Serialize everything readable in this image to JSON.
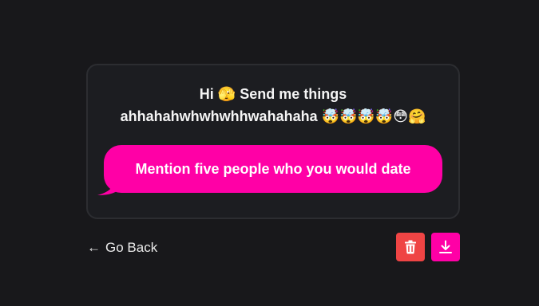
{
  "message": {
    "title": "Hi 🫣 Send me things ahhahahwhwhwhhwahahaha 🤯🤯🤯🤯😳🤗"
  },
  "reply": {
    "text": "Mention five people who you would date"
  },
  "navigation": {
    "back_arrow": "←",
    "back_label": "Go Back"
  },
  "actions": {
    "delete_icon": "trash-icon",
    "download_icon": "download-icon"
  },
  "colors": {
    "background": "#18181b",
    "card": "#1c1d21",
    "accent": "#ff00a6",
    "danger": "#ef4444"
  }
}
